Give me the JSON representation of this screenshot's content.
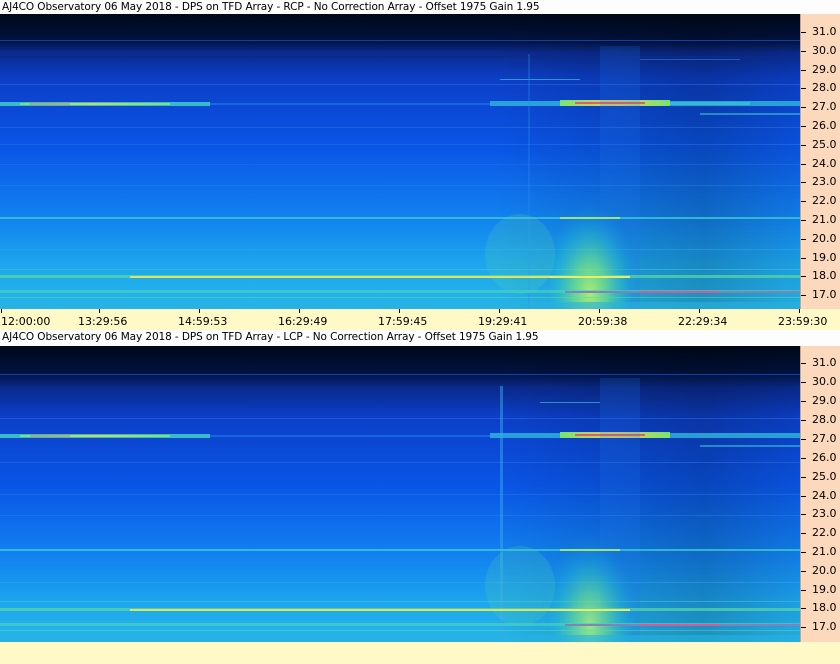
{
  "top": {
    "title": "AJ4CO Observatory 06 May 2018 - DPS on TFD Array  - RCP  -  No Correction Array  -  Offset 1975  Gain 1.95",
    "freq_labels": [
      "31.0",
      "30.0",
      "29.0",
      "28.0",
      "27.0",
      "26.0",
      "25.0",
      "24.0",
      "23.0",
      "22.0",
      "21.0",
      "20.0",
      "19.0",
      "18.0",
      "17.0"
    ],
    "time_labels": [
      "12:00:00",
      "13:29:56",
      "14:59:53",
      "16:29:49",
      "17:59:45",
      "19:29:41",
      "20:59:38",
      "22:29:34",
      "23:59:30"
    ]
  },
  "bottom": {
    "title": "AJ4CO Observatory 06 May 2018 - DPS on TFD Array  - LCP  -  No Correction Array  -  Offset 1975  Gain 1.95",
    "freq_labels": [
      "31.0",
      "30.0",
      "29.0",
      "28.0",
      "27.0",
      "26.0",
      "25.0",
      "24.0",
      "23.0",
      "22.0",
      "21.0",
      "20.0",
      "19.0",
      "18.0",
      "17.0"
    ],
    "time_labels": []
  },
  "colors": {
    "axis_bg": "#fcd9bd",
    "time_bar_bg": "#fff9c8",
    "spectrogram_dark": "#000a2a",
    "spectrogram_mid": "#0a4fe0",
    "spectrogram_light": "#3fc3f0",
    "burst_glow": "#8ff07a"
  }
}
